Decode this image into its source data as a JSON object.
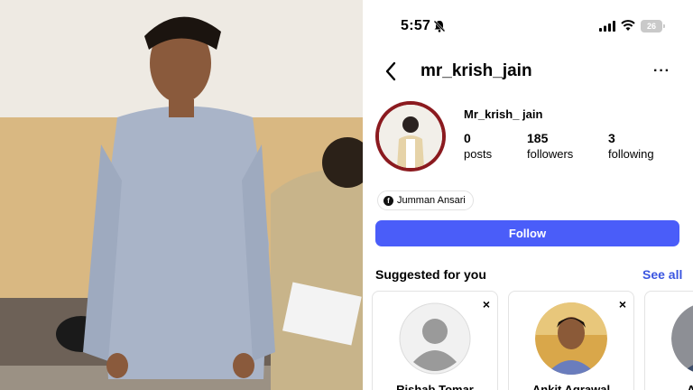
{
  "status_bar": {
    "time": "5:57",
    "battery": "26"
  },
  "nav": {
    "username": "mr_krish_jain",
    "more_label": "···"
  },
  "profile": {
    "display_name": "Mr_krish_ jain",
    "stats": [
      {
        "value": "0",
        "label": "posts"
      },
      {
        "value": "185",
        "label": "followers"
      },
      {
        "value": "3",
        "label": "following"
      }
    ],
    "mutual_label": "Jumman Ansari",
    "follow_label": "Follow"
  },
  "suggested": {
    "heading": "Suggested for you",
    "see_all": "See all",
    "cards": [
      {
        "name": "Rishab Tomar",
        "dismiss": "×"
      },
      {
        "name": "Ankit Agrawal",
        "dismiss": "×"
      },
      {
        "name": "Anurag",
        "dismiss": ""
      }
    ]
  },
  "colors": {
    "follow_button": "#4a5df9",
    "see_all": "#3a55e0",
    "avatar_ring": "#8b1a1f"
  }
}
